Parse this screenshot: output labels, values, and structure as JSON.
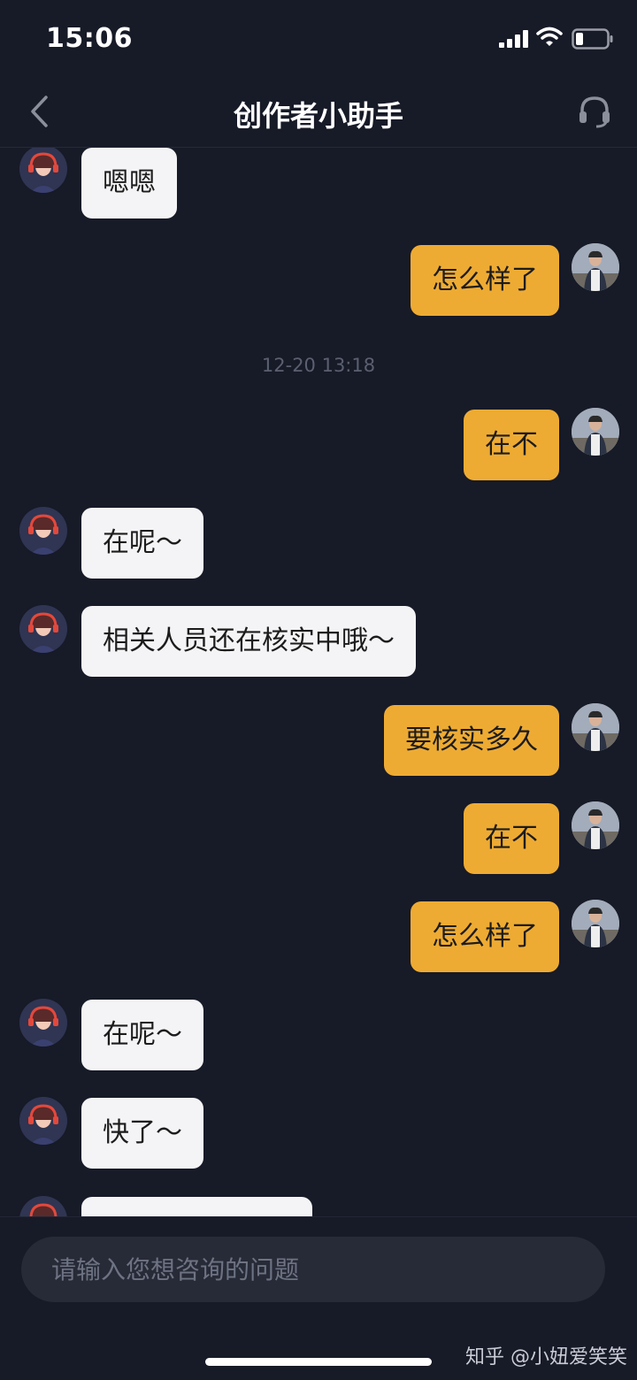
{
  "status": {
    "time": "15:06"
  },
  "header": {
    "title": "创作者小助手",
    "back_icon": "chevron-left-icon",
    "service_icon": "headset-icon"
  },
  "messages": [
    {
      "from": "bot",
      "text": "嗯嗯"
    },
    {
      "from": "me",
      "text": "怎么样了"
    },
    {
      "timestamp": "12-20 13:18"
    },
    {
      "from": "me",
      "text": "在不"
    },
    {
      "from": "bot",
      "text": "在呢～"
    },
    {
      "from": "bot",
      "text": "相关人员还在核实中哦～"
    },
    {
      "from": "me",
      "text": "要核实多久"
    },
    {
      "from": "me",
      "text": "在不"
    },
    {
      "from": "me",
      "text": "怎么样了"
    },
    {
      "from": "bot",
      "text": "在呢～"
    },
    {
      "from": "bot",
      "text": "快了～"
    }
  ],
  "input": {
    "placeholder": "请输入您想咨询的问题"
  },
  "watermark": "知乎 @小妞爱笑笑",
  "colors": {
    "background": "#171a27",
    "user_bubble": "#eeab33",
    "bot_bubble": "#f4f4f6"
  }
}
